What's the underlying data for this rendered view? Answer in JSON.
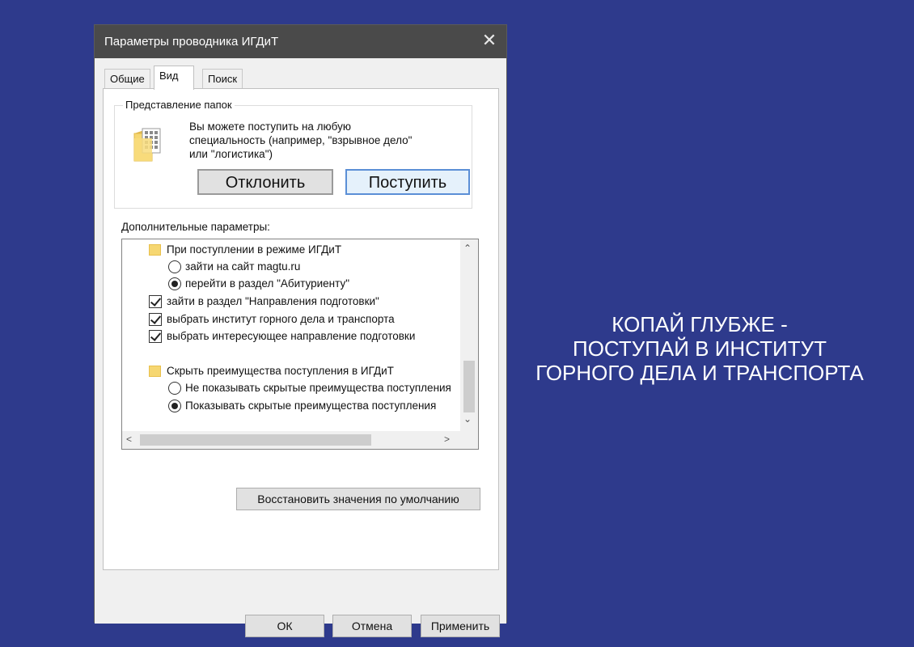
{
  "window": {
    "title": "Параметры проводника ИГДиТ",
    "close_symbol": "✕"
  },
  "tabs": [
    {
      "label": "Общие",
      "active": false
    },
    {
      "label": "Вид",
      "active": true
    },
    {
      "label": "Поиск",
      "active": false
    }
  ],
  "folder_views": {
    "legend": "Представление папок",
    "text_lines": [
      "Вы можете поступить на любую",
      "специальность (например, \"взрывное дело\"",
      "или \"логистика\")"
    ],
    "decline_label": "Отклонить",
    "enroll_label": "Поступить",
    "icon": "folder-grid-icon"
  },
  "advanced": {
    "label": "Дополнительные параметры:",
    "items": [
      {
        "type": "folder",
        "text": "При поступлении в режиме ИГДиТ"
      },
      {
        "type": "radio",
        "checked": false,
        "text": "зайти на сайт magtu.ru"
      },
      {
        "type": "radio",
        "checked": true,
        "text": "перейти в раздел \"Абитуриенту\""
      },
      {
        "type": "check",
        "checked": true,
        "text": "зайти в раздел \"Направления подготовки\""
      },
      {
        "type": "check",
        "checked": true,
        "text": "выбрать институт горного дела и транспорта"
      },
      {
        "type": "check",
        "checked": true,
        "text": "выбрать интересующее направление подготовки"
      },
      {
        "type": "folder",
        "text": "Скрыть преимущества поступления в ИГДиТ"
      },
      {
        "type": "radio",
        "checked": false,
        "text": "Не показывать скрытые преимущества поступления"
      },
      {
        "type": "radio",
        "checked": true,
        "text": "Показывать скрытые преимущества поступления"
      }
    ],
    "scroll_up": "⌃",
    "scroll_down": "⌄",
    "scroll_left": "<",
    "scroll_right": ">"
  },
  "restore_label": "Восстановить значения по умолчанию",
  "buttons": {
    "ok": "ОК",
    "cancel": "Отмена",
    "apply": "Применить"
  },
  "slogan": [
    "КОПАЙ ГЛУБЖЕ -",
    "ПОСТУПАЙ В ИНСТИТУТ",
    "ГОРНОГО ДЕЛА И ТРАНСПОРТА"
  ],
  "colors": {
    "background": "#2e3a8c",
    "titlebar": "#4a4a4a",
    "folder": "#f6d772",
    "focus_border": "#5b8fd6"
  }
}
